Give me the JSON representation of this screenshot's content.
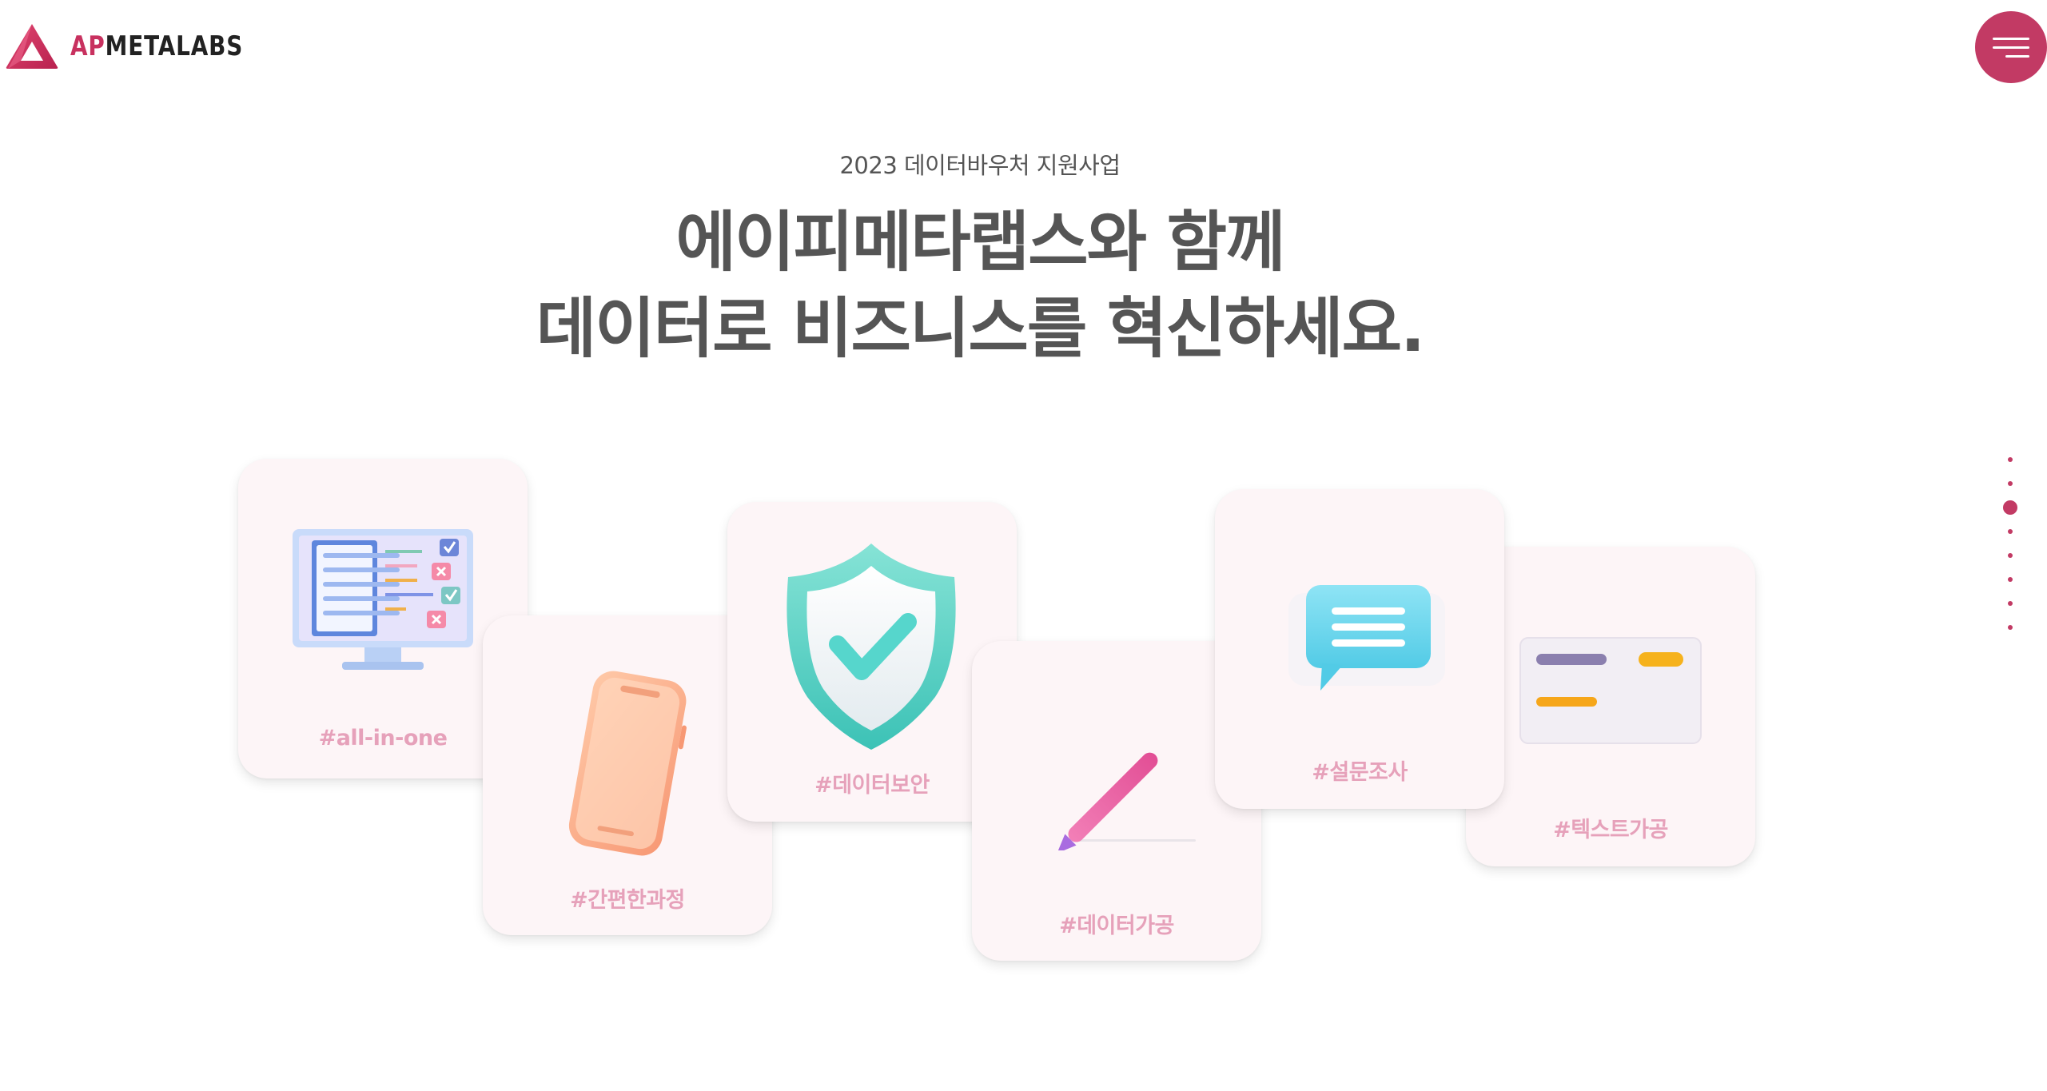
{
  "header": {
    "logo_ap": "AP",
    "logo_rest": "METALABS",
    "menu_icon": "hamburger-menu-icon"
  },
  "hero": {
    "subtitle": "2023 데이터바우처 지원사업",
    "headline_line1": "에이피메타랩스와 함께",
    "headline_line2": "데이터로 비즈니스를 혁신하세요."
  },
  "cards": [
    {
      "tag": "#all-in-one",
      "icon": "monitor-checklist-icon"
    },
    {
      "tag": "#간편한과정",
      "icon": "smartphone-icon"
    },
    {
      "tag": "#데이터보안",
      "icon": "shield-check-icon"
    },
    {
      "tag": "#데이터가공",
      "icon": "pen-icon"
    },
    {
      "tag": "#설문조사",
      "icon": "speech-bubble-icon"
    },
    {
      "tag": "#텍스트가공",
      "icon": "text-card-icon"
    }
  ],
  "pagination": {
    "count": 8,
    "active_index": 2
  },
  "colors": {
    "brand": "#c23a64",
    "tag": "#e6a1ba",
    "card_bg": "#fdf5f7",
    "text": "#555555"
  }
}
